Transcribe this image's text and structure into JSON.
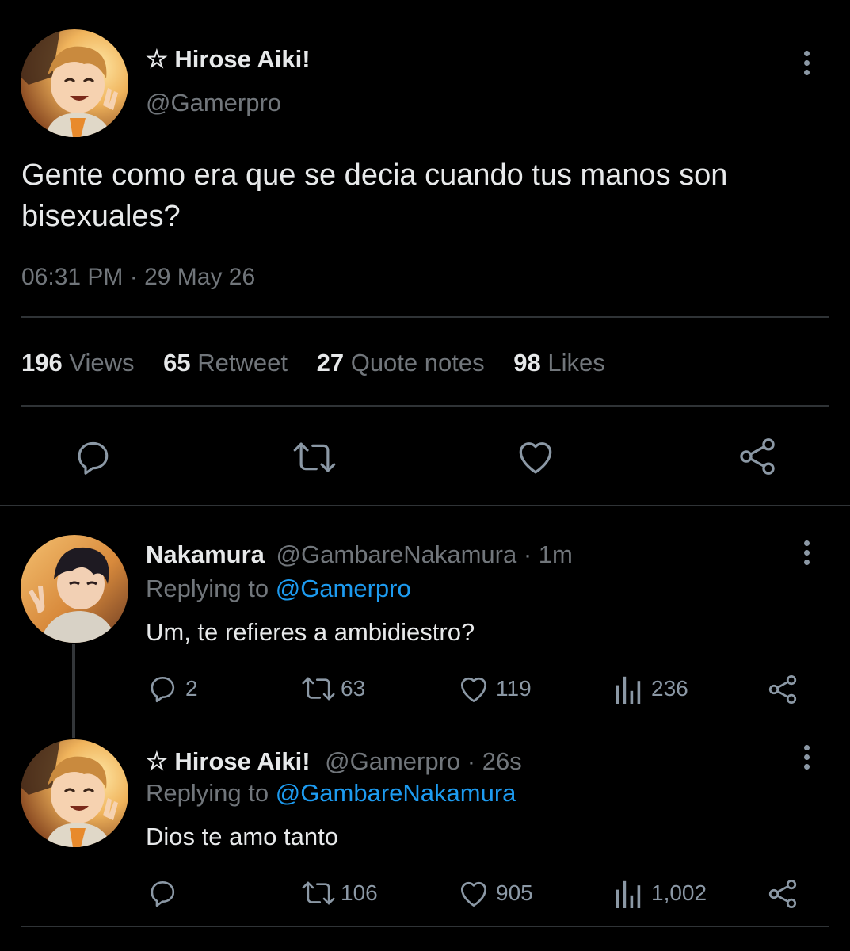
{
  "main_tweet": {
    "display_name": "☆ Hirose Aiki!",
    "handle": "@Gamerpro",
    "text_line1": "Gente como era que se decia cuando tus manos son",
    "text_line2": "bisexuales?",
    "timestamp": "06:31 PM · 29 May 26",
    "stats": {
      "views_count": "196",
      "views_label": "Views",
      "retweet_count": "65",
      "retweet_label": "Retweet",
      "quote_count": "27",
      "quote_label": "Quote notes",
      "likes_count": "98",
      "likes_label": "Likes"
    },
    "actions": [
      "reply-icon",
      "retweet-icon",
      "like-icon",
      "share-icon"
    ]
  },
  "replies": [
    {
      "display_name": "Nakamura",
      "handle_time": "@GambareNakamura · 1m",
      "replying_prefix": "Replying to",
      "replying_handle": "@Gamerpro",
      "text": "Um, te refieres a ambidiestro?",
      "reply_count": "2",
      "retweet_count": "63",
      "like_count": "119",
      "views_count": "236"
    },
    {
      "display_name": "☆ Hirose Aiki!",
      "handle_time": "@Gamerpro · 26s",
      "replying_prefix": "Replying to",
      "replying_handle": "@GambareNakamura",
      "text": "Dios te amo tanto",
      "reply_count": "",
      "retweet_count": "106",
      "like_count": "905",
      "views_count": "1,002"
    }
  ],
  "colors": {
    "background": "#000000",
    "text": "#e7e9ea",
    "secondary": "#71767b",
    "link": "#1d9bf0",
    "divider": "#2f3336"
  }
}
